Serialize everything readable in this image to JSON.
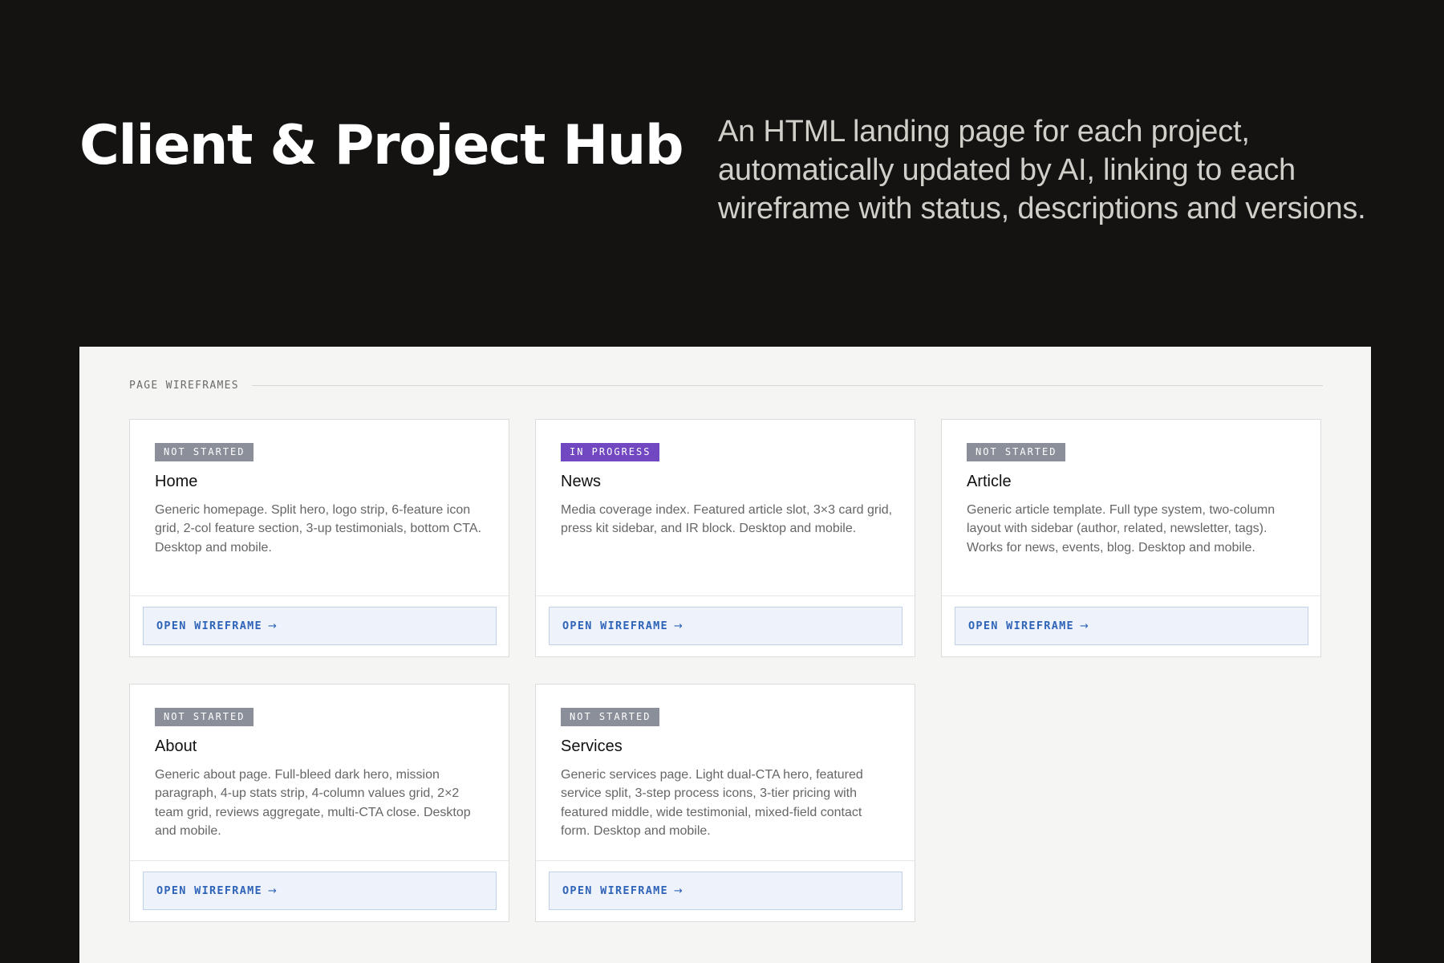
{
  "hero": {
    "title": "Client & Project Hub",
    "description": "An HTML landing page for each project, automatically updated by AI, linking to each wireframe with status, descriptions and versions."
  },
  "section": {
    "label": "PAGE WIREFRAMES"
  },
  "colors": {
    "background": "#141311",
    "panel": "#f5f5f3",
    "status_not_started": "#8a8f9a",
    "status_in_progress": "#7248c2",
    "link_accent": "#2f64b8"
  },
  "cards": [
    {
      "status": "NOT STARTED",
      "status_color": "#8a8f9a",
      "title": "Home",
      "description": "Generic homepage. Split hero, logo strip, 6-feature icon grid, 2-col feature section, 3-up testimonials, bottom CTA. Desktop and mobile.",
      "link_label": "OPEN WIREFRAME",
      "link_icon": "arrow-right-icon"
    },
    {
      "status": "IN PROGRESS",
      "status_color": "#7248c2",
      "title": "News",
      "description": "Media coverage index. Featured article slot, 3×3 card grid, press kit sidebar, and IR block. Desktop and mobile.",
      "link_label": "OPEN WIREFRAME",
      "link_icon": "arrow-right-icon"
    },
    {
      "status": "NOT STARTED",
      "status_color": "#8a8f9a",
      "title": "Article",
      "description": "Generic article template. Full type system, two-column layout with sidebar (author, related, newsletter, tags). Works for news, events, blog. Desktop and mobile.",
      "link_label": "OPEN WIREFRAME",
      "link_icon": "arrow-right-icon"
    },
    {
      "status": "NOT STARTED",
      "status_color": "#8a8f9a",
      "title": "About",
      "description": "Generic about page. Full-bleed dark hero, mission paragraph, 4-up stats strip, 4-column values grid, 2×2 team grid, reviews aggregate, multi-CTA close. Desktop and mobile.",
      "link_label": "OPEN WIREFRAME",
      "link_icon": "arrow-right-icon"
    },
    {
      "status": "NOT STARTED",
      "status_color": "#8a8f9a",
      "title": "Services",
      "description": "Generic services page. Light dual-CTA hero, featured service split, 3-step process icons, 3-tier pricing with featured middle, wide testimonial, mixed-field contact form. Desktop and mobile.",
      "link_label": "OPEN WIREFRAME",
      "link_icon": "arrow-right-icon"
    }
  ]
}
